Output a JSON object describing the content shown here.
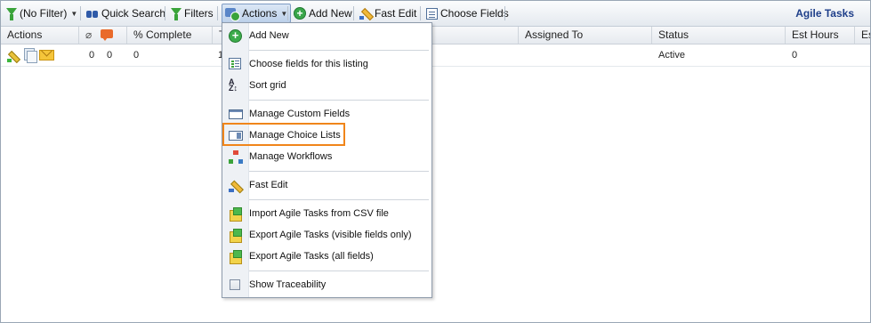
{
  "toolbar": {
    "filter_label": "(No Filter)",
    "quick_search_label": "Quick Search",
    "filters_label": "Filters",
    "actions_label": "Actions",
    "add_new_label": "Add New",
    "fast_edit_label": "Fast Edit",
    "choose_fields_label": "Choose Fields",
    "page_title": "Agile Tasks"
  },
  "grid": {
    "columns": [
      "Actions",
      "% Complete",
      "T",
      "Assigned To",
      "Status",
      "Est Hours",
      "Es"
    ],
    "row": {
      "attachments": "0",
      "comments": "0",
      "percent_complete": "0",
      "title_fragment": "1",
      "status": "Active",
      "est_hours": "0"
    }
  },
  "menu": {
    "items": [
      {
        "label": "Add New",
        "icon": "add-circle-icon"
      },
      {
        "label": "Choose fields for this listing",
        "icon": "field-list-icon"
      },
      {
        "label": "Sort grid",
        "icon": "sort-az-icon"
      },
      {
        "label": "Manage Custom Fields",
        "icon": "window-icon"
      },
      {
        "label": "Manage Choice Lists",
        "icon": "combo-box-icon"
      },
      {
        "label": "Manage Workflows",
        "icon": "workflow-icon"
      },
      {
        "label": "Fast Edit",
        "icon": "pencil-icon"
      },
      {
        "label": "Import Agile Tasks from CSV file",
        "icon": "import-box-icon"
      },
      {
        "label": "Export Agile Tasks (visible fields only)",
        "icon": "export-box-icon"
      },
      {
        "label": "Export Agile Tasks (all fields)",
        "icon": "export-box-icon"
      },
      {
        "label": "Show Traceability",
        "icon": "checkbox-icon"
      }
    ]
  },
  "colors": {
    "highlight": "#f0851a",
    "title": "#1f3f8a"
  }
}
